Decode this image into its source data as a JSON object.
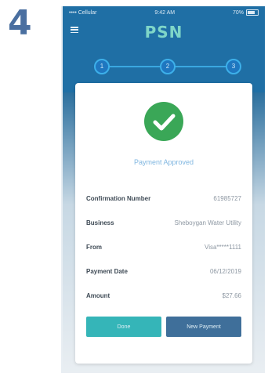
{
  "step_number": "4",
  "status_bar": {
    "carrier": "•••• Cellular",
    "time": "9:42 AM",
    "battery": "70%"
  },
  "app": {
    "logo": "PSN"
  },
  "stepper": {
    "steps": [
      "1",
      "2",
      "3"
    ]
  },
  "payment": {
    "status": "Payment Approved",
    "rows": [
      {
        "label": "Confirmation Number",
        "value": "61985727"
      },
      {
        "label": "Business",
        "value": "Sheboygan Water Utility"
      },
      {
        "label": "From",
        "value": "Visa*****1111"
      },
      {
        "label": "Payment Date",
        "value": "06/12/2019"
      },
      {
        "label": "Amount",
        "value": "$27.66"
      }
    ]
  },
  "buttons": {
    "done": "Done",
    "new_payment": "New Payment"
  },
  "colors": {
    "header_blue": "#1f6fa5",
    "success_green": "#3aa757",
    "done_teal": "#35b5b8",
    "new_payment_blue": "#3f6f9a"
  }
}
